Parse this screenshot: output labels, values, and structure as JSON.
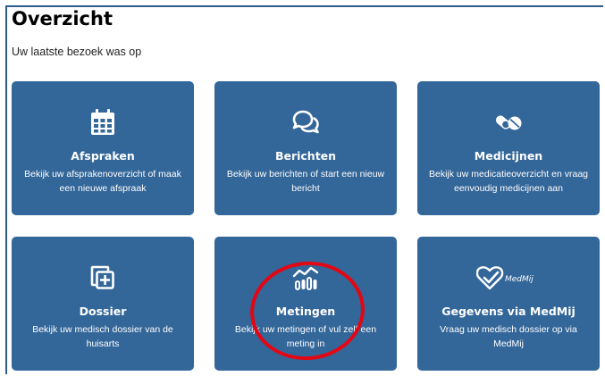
{
  "page": {
    "title": "Overzicht",
    "last_visit": "Uw laatste bezoek was op"
  },
  "cards": [
    {
      "id": "afspraken",
      "icon": "calendar-icon",
      "title": "Afspraken",
      "description": "Bekijk uw afsprakenoverzicht of maak een nieuwe afspraak"
    },
    {
      "id": "berichten",
      "icon": "chat-bubbles-icon",
      "title": "Berichten",
      "description": "Bekijk uw berichten of start een nieuw bericht"
    },
    {
      "id": "medicijnen",
      "icon": "pills-icon",
      "title": "Medicijnen",
      "description": "Bekijk uw medicatieoverzicht en vraag eenvoudig medicijnen aan"
    },
    {
      "id": "dossier",
      "icon": "dossier-plus-icon",
      "title": "Dossier",
      "description": "Bekijk uw medisch dossier van de huisarts"
    },
    {
      "id": "metingen",
      "icon": "measurements-chart-icon",
      "title": "Metingen",
      "description": "Bekijk uw metingen of vul zelf een meting in"
    },
    {
      "id": "medmij",
      "icon": "medmij-logo-icon",
      "logo_text": "MedMij",
      "title": "Gegevens via MedMij",
      "description": "Vraag uw medisch dossier op via MedMij"
    }
  ],
  "colors": {
    "card_background": "#336699",
    "card_text": "#ffffff",
    "frame_border": "#2d5c8c",
    "annotation_circle": "#e30613"
  }
}
